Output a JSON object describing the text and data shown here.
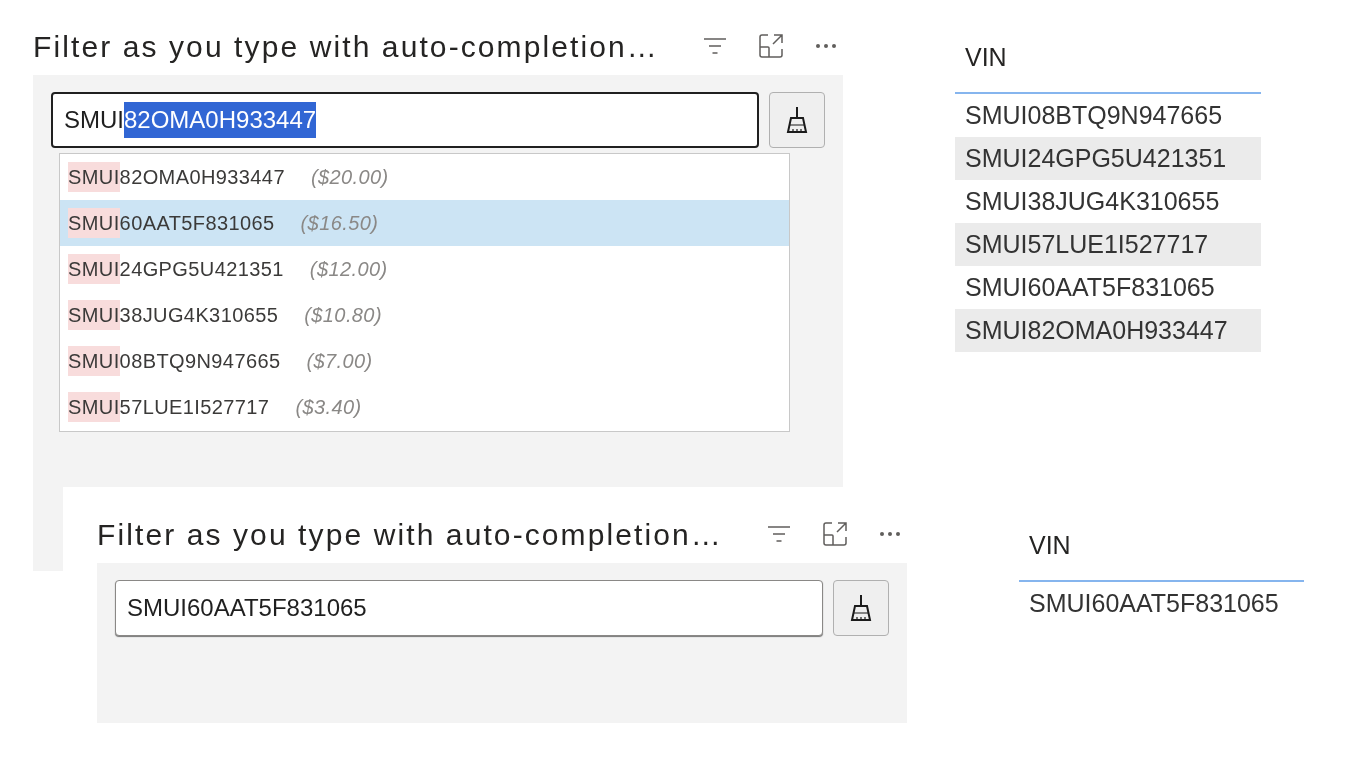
{
  "screenshots": [
    {
      "slicer": {
        "title": "Filter as you type with auto-completion…",
        "search": {
          "focused": true,
          "value": [
            {
              "text": "SMUI",
              "selected": false
            },
            {
              "text": "82OMA0H933447",
              "selected": true
            }
          ]
        },
        "suggestions": [
          {
            "match": "SMUI",
            "rest": "82OMA0H933447",
            "price": "($20.00)",
            "selected": false
          },
          {
            "match": "SMUI",
            "rest": "60AAT5F831065",
            "price": "($16.50)",
            "selected": true
          },
          {
            "match": "SMUI",
            "rest": "24GPG5U421351",
            "price": "($12.00)",
            "selected": false
          },
          {
            "match": "SMUI",
            "rest": "38JUG4K310655",
            "price": "($10.80)",
            "selected": false
          },
          {
            "match": "SMUI",
            "rest": "08BTQ9N947665",
            "price": "($7.00)",
            "selected": false
          },
          {
            "match": "SMUI",
            "rest": "57LUE1I527717",
            "price": "($3.40)",
            "selected": false
          }
        ]
      },
      "table": {
        "columns": [
          "VIN"
        ],
        "rows": [
          "SMUI08BTQ9N947665",
          "SMUI24GPG5U421351",
          "SMUI38JUG4K310655",
          "SMUI57LUE1I527717",
          "SMUI60AAT5F831065",
          "SMUI82OMA0H933447"
        ]
      }
    },
    {
      "slicer": {
        "title": "Filter as you type with auto-completion…",
        "search": {
          "focused": false,
          "value": [
            {
              "text": "SMUI60AAT5F831065",
              "selected": false
            }
          ]
        }
      },
      "table": {
        "columns": [
          "VIN"
        ],
        "rows": [
          "SMUI60AAT5F831065"
        ]
      }
    }
  ]
}
